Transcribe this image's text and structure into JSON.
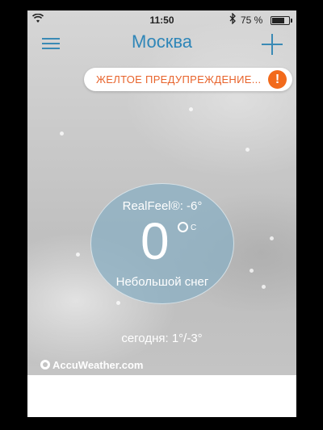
{
  "status_bar": {
    "time": "11:50",
    "battery_text": "75 %",
    "battery_level_percent": 75
  },
  "header": {
    "city": "Москва",
    "menu_icon": "hamburger-menu-icon",
    "add_icon": "plus-icon"
  },
  "alert": {
    "text": "ЖЕЛТОЕ ПРЕДУПРЕЖДЕНИЕ...",
    "icon_text": "!",
    "icon_color": "#f26a1b",
    "text_color": "#e8632b"
  },
  "current": {
    "realfeel": "RealFeel®: -6°",
    "temperature": "0",
    "unit": "C",
    "condition": "Небольшой снег"
  },
  "today": "сегодня: 1°/-3°",
  "brand": "AccuWeather.com",
  "colors": {
    "accent": "#2f86b8",
    "background": "#c4c4c4"
  }
}
